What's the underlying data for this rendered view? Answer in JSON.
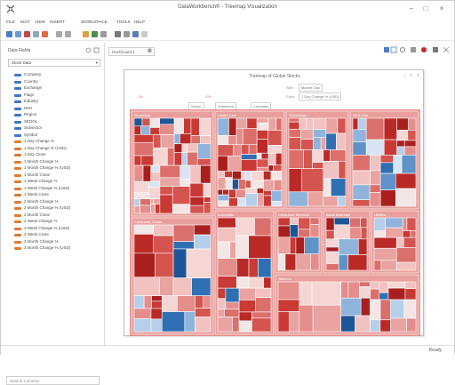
{
  "window": {
    "title": "DataWorkbench® - Treemap Visualization"
  },
  "menu": [
    "FILE",
    "EDIT",
    "VIEW",
    "INSERT",
    "WORKSPACE",
    "TOOLS",
    "HELP"
  ],
  "left_panel": {
    "title": "Data Fields",
    "symbol_select": "Stock Data",
    "items": [
      {
        "label": "Company",
        "kind": "dim"
      },
      {
        "label": "Country",
        "kind": "dim"
      },
      {
        "label": "Exchange",
        "kind": "dim"
      },
      {
        "label": "Flags",
        "kind": "dim"
      },
      {
        "label": "Industry",
        "kind": "dim"
      },
      {
        "label": "ISIN",
        "kind": "dim"
      },
      {
        "label": "Region",
        "kind": "dim"
      },
      {
        "label": "SEDOL",
        "kind": "dim"
      },
      {
        "label": "Subsector",
        "kind": "dim"
      },
      {
        "label": "Symbol",
        "kind": "dim"
      },
      {
        "label": "1 Day Change %",
        "kind": "measure"
      },
      {
        "label": "1 Day Change % (USD)",
        "kind": "measure"
      },
      {
        "label": "1 Day Close",
        "kind": "measure"
      },
      {
        "label": "1 Month Change %",
        "kind": "measure"
      },
      {
        "label": "1 Month Change % (USD)",
        "kind": "measure"
      },
      {
        "label": "1 Month Close",
        "kind": "measure"
      },
      {
        "label": "1 Week Change %",
        "kind": "measure"
      },
      {
        "label": "1 Week Change % (USD)",
        "kind": "measure"
      },
      {
        "label": "1 Week Close",
        "kind": "measure"
      },
      {
        "label": "2 Month Change %",
        "kind": "measure"
      },
      {
        "label": "2 Month Change % (USD)",
        "kind": "measure"
      },
      {
        "label": "2 Month Close",
        "kind": "measure"
      },
      {
        "label": "2 Week Change %",
        "kind": "measure"
      },
      {
        "label": "2 Week Change % (USD)",
        "kind": "measure"
      },
      {
        "label": "2 Week Close",
        "kind": "measure"
      },
      {
        "label": "3 Month Change %",
        "kind": "measure"
      },
      {
        "label": "3 Month Change % (USD)",
        "kind": "measure"
      }
    ],
    "search_placeholder": "Search Columns"
  },
  "workspace": {
    "page_tab": "Dashboard 1"
  },
  "panel": {
    "title": "Treemap of Global Stocks",
    "size_label": "Size",
    "size_value": "Market Cap",
    "color_label": "Color",
    "color_value": "1 Day Change % (USD)",
    "group_left": "Sector",
    "group_mid": "Subsector",
    "group_right": "Company",
    "legend_min": "-3%",
    "legend_max": "+3%"
  },
  "treemap": {
    "groups": [
      {
        "label": "Financials"
      },
      {
        "label": "Health Care"
      },
      {
        "label": "Technology"
      },
      {
        "label": "Oil & Gas"
      },
      {
        "label": "Consumer Goods"
      },
      {
        "label": "Industrials"
      },
      {
        "label": "Consumer Services"
      },
      {
        "label": "Basic Materials"
      },
      {
        "label": "Utilities"
      },
      {
        "label": "Telecom"
      }
    ]
  },
  "status": {
    "text": "Ready"
  },
  "colors": {
    "accent": "#2e7bbf",
    "negative": "#c8252b",
    "positive": "#2b6fb8"
  }
}
